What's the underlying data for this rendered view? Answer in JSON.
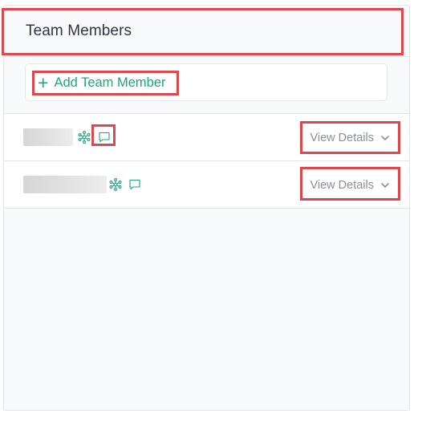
{
  "panel": {
    "title": "Team Members"
  },
  "add_member": {
    "label": "Add Team Member",
    "icon": "plus-icon"
  },
  "members": [
    {
      "status_icon": "network-icon",
      "message_icon": "chat-bubble-icon",
      "details_label": "View Details",
      "details_icon": "chevron-down-icon"
    },
    {
      "status_icon": "network-icon",
      "message_icon": "chat-bubble-icon",
      "details_label": "View Details",
      "details_icon": "chevron-down-icon"
    }
  ],
  "colors": {
    "accent": "#1ca67a",
    "highlight": "#e0474c",
    "muted_text": "#8a8f98",
    "title_text": "#2f3542"
  }
}
